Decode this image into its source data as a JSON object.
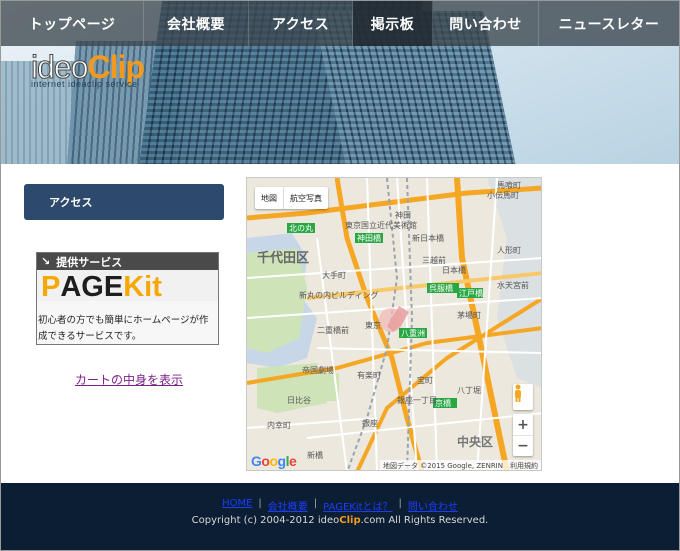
{
  "nav": {
    "items": [
      {
        "label": "トップページ",
        "width": 143
      },
      {
        "label": "会社概要",
        "width": 105
      },
      {
        "label": "アクセス",
        "width": 104
      },
      {
        "label": "掲示板",
        "width": 80
      },
      {
        "label": "問い合わせ",
        "width": 106
      },
      {
        "label": "ニュースレター",
        "width": 140
      }
    ],
    "active_index": 3
  },
  "logo": {
    "ideo": "ideo",
    "clip": "Clip",
    "tagline": "internet ideaclip service"
  },
  "sidebar": {
    "heading": "アクセス",
    "service_tag": "提供サービス",
    "service_logo_p": "P",
    "service_logo_age": "AGE",
    "service_logo_kit": "Kit",
    "service_desc": "初心者の方でも簡単にホームページが作成できるサービスです。",
    "cart_link": "カートの中身を表示"
  },
  "map": {
    "type_map": "地図",
    "type_satellite": "航空写真",
    "zoom_in": "+",
    "zoom_out": "−",
    "attribution": "地図データ ©2015 Google, ZENRIN　利用規約",
    "labels": [
      {
        "text": "千代田区"
      },
      {
        "text": "中央区"
      },
      {
        "text": "東京"
      },
      {
        "text": "神田"
      },
      {
        "text": "大手町"
      },
      {
        "text": "新日本橋"
      },
      {
        "text": "三越前"
      },
      {
        "text": "日本橋"
      },
      {
        "text": "八重洲"
      },
      {
        "text": "京橋"
      },
      {
        "text": "宝町"
      },
      {
        "text": "銀座一丁目"
      },
      {
        "text": "銀座"
      },
      {
        "text": "有楽町"
      },
      {
        "text": "日比谷"
      },
      {
        "text": "内幸町"
      },
      {
        "text": "新橋"
      },
      {
        "text": "茅場町"
      },
      {
        "text": "八丁堀"
      },
      {
        "text": "人形町"
      },
      {
        "text": "小伝馬町"
      },
      {
        "text": "馬喰町"
      },
      {
        "text": "水天宮前"
      },
      {
        "text": "竹橋"
      },
      {
        "text": "北の丸"
      },
      {
        "text": "二重橋前"
      },
      {
        "text": "帝国劇場"
      },
      {
        "text": "新丸の内ビルディング"
      },
      {
        "text": "東京国立近代美術館"
      }
    ]
  },
  "footer": {
    "links": [
      "HOME",
      "会社概要",
      "PAGEKitとは？",
      "問い合わせ"
    ],
    "copyright_pre": "Copyright (c) 2004-2012 ideo",
    "copyright_clip": "Clip",
    "copyright_post": ".com All Rights Reserved."
  }
}
